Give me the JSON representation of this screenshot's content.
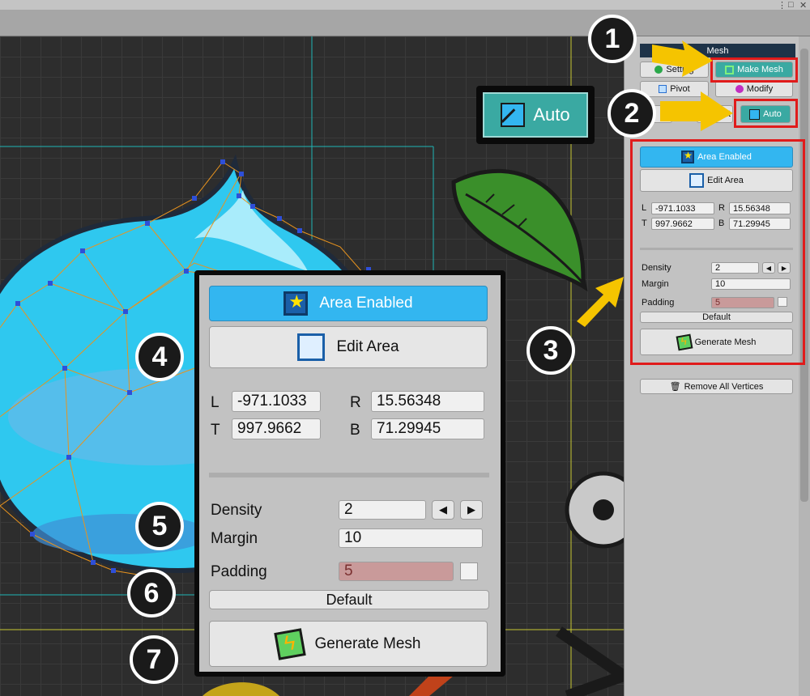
{
  "window": {
    "controls": [
      "⋮",
      "□",
      "✕"
    ]
  },
  "callouts": {
    "n1": "1",
    "n2": "2",
    "n3": "3",
    "n4": "4",
    "n5": "5",
    "n6": "6",
    "n7": "7"
  },
  "panel": {
    "title": "Mesh",
    "tabs": {
      "setting": "Setting",
      "make_mesh": "Make Mesh",
      "pivot": "Pivot",
      "modify": "Modify",
      "add_partial": "A",
      "edit_partial": "it",
      "auto": "Auto"
    },
    "area_enabled": "Area Enabled",
    "edit_area": "Edit Area",
    "bounds": {
      "L_label": "L",
      "L": "-971.1033",
      "R_label": "R",
      "R": "15.56348",
      "T_label": "T",
      "T": "997.9662",
      "B_label": "B",
      "B": "71.29945"
    },
    "density_label": "Density",
    "density": "2",
    "margin_label": "Margin",
    "margin": "10",
    "padding_label": "Padding",
    "padding": "5",
    "default": "Default",
    "generate_mesh": "Generate Mesh",
    "remove_all": "Remove All Vertices"
  },
  "auto_callout": {
    "label": "Auto"
  },
  "colors": {
    "accent_teal": "#3aa9a2",
    "area_blue": "#33b6f0",
    "highlight_red": "#e01b1b",
    "arrow_yellow": "#f5c400",
    "mesh_orange": "#e8931e"
  }
}
